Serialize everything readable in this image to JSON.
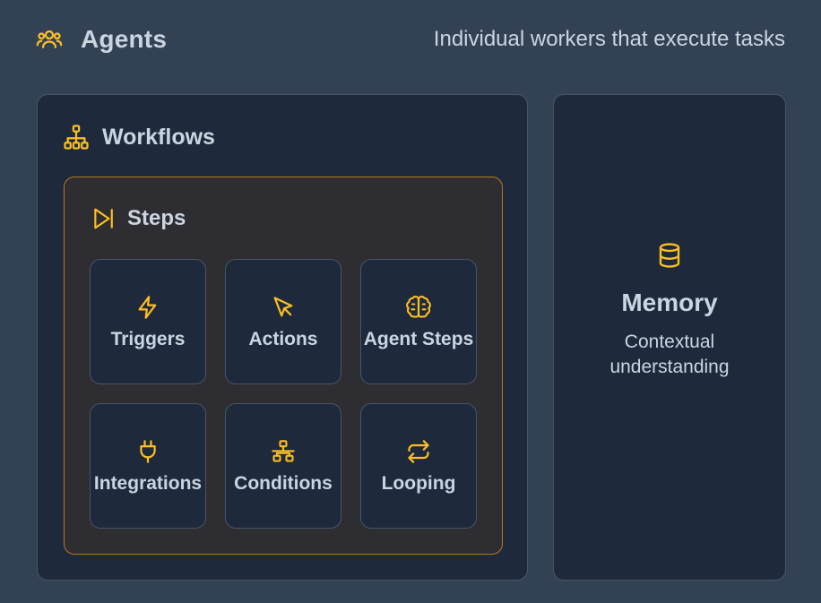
{
  "colors": {
    "accent": "#fbbf24",
    "background": "#334155",
    "panel": "#1e293b",
    "steps_panel": "#2e2d31",
    "steps_border": "#b7791f",
    "border": "#475569",
    "text": "#cbd5e1"
  },
  "header": {
    "icon": "users-icon",
    "title": "Agents",
    "description": "Individual workers that execute tasks"
  },
  "workflows": {
    "icon": "sitemap-icon",
    "title": "Workflows",
    "steps": {
      "icon": "step-forward-icon",
      "title": "Steps",
      "items": [
        {
          "icon": "zap-icon",
          "label": "Triggers"
        },
        {
          "icon": "mouse-pointer-icon",
          "label": "Actions"
        },
        {
          "icon": "brain-icon",
          "label": "Agent Steps"
        },
        {
          "icon": "plug-icon",
          "label": "Integrations"
        },
        {
          "icon": "network-icon",
          "label": "Conditions"
        },
        {
          "icon": "repeat-icon",
          "label": "Looping"
        }
      ]
    }
  },
  "memory": {
    "icon": "database-icon",
    "title": "Memory",
    "description": "Contextual understanding"
  }
}
